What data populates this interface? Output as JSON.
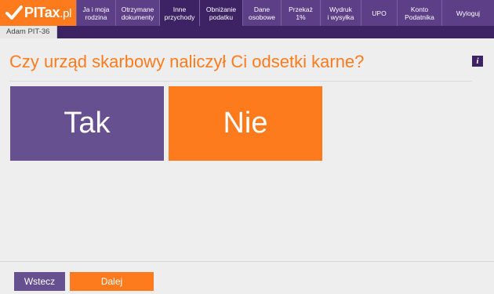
{
  "brand": {
    "name": "PITax",
    "tld": ".pl",
    "accent": "#fd7b1d",
    "primary": "#5c3f86"
  },
  "nav": {
    "items": [
      {
        "label": "Ja i moja\nrodzina",
        "active": false
      },
      {
        "label": "Otrzymane\ndokumenty",
        "active": false
      },
      {
        "label": "Inne\nprzychody",
        "active": true
      },
      {
        "label": "Obniżanie\npodatku",
        "active": true
      },
      {
        "label": "Dane\nosobowe",
        "active": false
      },
      {
        "label": "Przekaż\n1%",
        "active": false
      },
      {
        "label": "Wydruk\ni wysyłka",
        "active": false
      },
      {
        "label": "UPO",
        "active": false
      },
      {
        "label": "Konto\nPodatnika",
        "active": false
      },
      {
        "label": "Wyloguj",
        "active": false
      }
    ]
  },
  "person_tab": {
    "label": "Adam PIT-36"
  },
  "question": {
    "text": "Czy urząd skarbowy naliczył Ci odsetki karne?",
    "info_icon": "info-icon",
    "info_glyph": "i"
  },
  "answers": {
    "yes": "Tak",
    "no": "Nie"
  },
  "footer": {
    "back_label": "Wstecz",
    "next_label": "Dalej"
  }
}
